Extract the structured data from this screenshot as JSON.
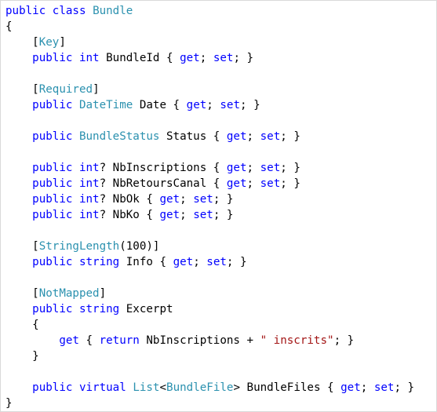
{
  "editor": {
    "colors": {
      "keyword": "#0000ff",
      "type": "#2b91af",
      "string": "#a31515",
      "plain": "#000000",
      "background": "#ffffff"
    },
    "lines": [
      [
        {
          "t": "public",
          "c": "kw"
        },
        {
          "t": " ",
          "c": "pl"
        },
        {
          "t": "class",
          "c": "kw"
        },
        {
          "t": " ",
          "c": "pl"
        },
        {
          "t": "Bundle",
          "c": "ty"
        }
      ],
      [
        {
          "t": "{",
          "c": "pl"
        }
      ],
      [
        {
          "t": "    [",
          "c": "pl"
        },
        {
          "t": "Key",
          "c": "ty"
        },
        {
          "t": "]",
          "c": "pl"
        }
      ],
      [
        {
          "t": "    ",
          "c": "pl"
        },
        {
          "t": "public",
          "c": "kw"
        },
        {
          "t": " ",
          "c": "pl"
        },
        {
          "t": "int",
          "c": "kw"
        },
        {
          "t": " BundleId { ",
          "c": "pl"
        },
        {
          "t": "get",
          "c": "kw"
        },
        {
          "t": "; ",
          "c": "pl"
        },
        {
          "t": "set",
          "c": "kw"
        },
        {
          "t": "; }",
          "c": "pl"
        }
      ],
      [],
      [
        {
          "t": "    [",
          "c": "pl"
        },
        {
          "t": "Required",
          "c": "ty"
        },
        {
          "t": "]",
          "c": "pl"
        }
      ],
      [
        {
          "t": "    ",
          "c": "pl"
        },
        {
          "t": "public",
          "c": "kw"
        },
        {
          "t": " ",
          "c": "pl"
        },
        {
          "t": "DateTime",
          "c": "ty"
        },
        {
          "t": " Date { ",
          "c": "pl"
        },
        {
          "t": "get",
          "c": "kw"
        },
        {
          "t": "; ",
          "c": "pl"
        },
        {
          "t": "set",
          "c": "kw"
        },
        {
          "t": "; }",
          "c": "pl"
        }
      ],
      [],
      [
        {
          "t": "    ",
          "c": "pl"
        },
        {
          "t": "public",
          "c": "kw"
        },
        {
          "t": " ",
          "c": "pl"
        },
        {
          "t": "BundleStatus",
          "c": "ty"
        },
        {
          "t": " Status { ",
          "c": "pl"
        },
        {
          "t": "get",
          "c": "kw"
        },
        {
          "t": "; ",
          "c": "pl"
        },
        {
          "t": "set",
          "c": "kw"
        },
        {
          "t": "; }",
          "c": "pl"
        }
      ],
      [],
      [
        {
          "t": "    ",
          "c": "pl"
        },
        {
          "t": "public",
          "c": "kw"
        },
        {
          "t": " ",
          "c": "pl"
        },
        {
          "t": "int",
          "c": "kw"
        },
        {
          "t": "? NbInscriptions { ",
          "c": "pl"
        },
        {
          "t": "get",
          "c": "kw"
        },
        {
          "t": "; ",
          "c": "pl"
        },
        {
          "t": "set",
          "c": "kw"
        },
        {
          "t": "; }",
          "c": "pl"
        }
      ],
      [
        {
          "t": "    ",
          "c": "pl"
        },
        {
          "t": "public",
          "c": "kw"
        },
        {
          "t": " ",
          "c": "pl"
        },
        {
          "t": "int",
          "c": "kw"
        },
        {
          "t": "? NbRetoursCanal { ",
          "c": "pl"
        },
        {
          "t": "get",
          "c": "kw"
        },
        {
          "t": "; ",
          "c": "pl"
        },
        {
          "t": "set",
          "c": "kw"
        },
        {
          "t": "; }",
          "c": "pl"
        }
      ],
      [
        {
          "t": "    ",
          "c": "pl"
        },
        {
          "t": "public",
          "c": "kw"
        },
        {
          "t": " ",
          "c": "pl"
        },
        {
          "t": "int",
          "c": "kw"
        },
        {
          "t": "? NbOk { ",
          "c": "pl"
        },
        {
          "t": "get",
          "c": "kw"
        },
        {
          "t": "; ",
          "c": "pl"
        },
        {
          "t": "set",
          "c": "kw"
        },
        {
          "t": "; }",
          "c": "pl"
        }
      ],
      [
        {
          "t": "    ",
          "c": "pl"
        },
        {
          "t": "public",
          "c": "kw"
        },
        {
          "t": " ",
          "c": "pl"
        },
        {
          "t": "int",
          "c": "kw"
        },
        {
          "t": "? NbKo { ",
          "c": "pl"
        },
        {
          "t": "get",
          "c": "kw"
        },
        {
          "t": "; ",
          "c": "pl"
        },
        {
          "t": "set",
          "c": "kw"
        },
        {
          "t": "; }",
          "c": "pl"
        }
      ],
      [],
      [
        {
          "t": "    [",
          "c": "pl"
        },
        {
          "t": "StringLength",
          "c": "ty"
        },
        {
          "t": "(100)]",
          "c": "pl"
        }
      ],
      [
        {
          "t": "    ",
          "c": "pl"
        },
        {
          "t": "public",
          "c": "kw"
        },
        {
          "t": " ",
          "c": "pl"
        },
        {
          "t": "string",
          "c": "kw"
        },
        {
          "t": " Info { ",
          "c": "pl"
        },
        {
          "t": "get",
          "c": "kw"
        },
        {
          "t": "; ",
          "c": "pl"
        },
        {
          "t": "set",
          "c": "kw"
        },
        {
          "t": "; }",
          "c": "pl"
        }
      ],
      [],
      [
        {
          "t": "    [",
          "c": "pl"
        },
        {
          "t": "NotMapped",
          "c": "ty"
        },
        {
          "t": "]",
          "c": "pl"
        }
      ],
      [
        {
          "t": "    ",
          "c": "pl"
        },
        {
          "t": "public",
          "c": "kw"
        },
        {
          "t": " ",
          "c": "pl"
        },
        {
          "t": "string",
          "c": "kw"
        },
        {
          "t": " Excerpt",
          "c": "pl"
        }
      ],
      [
        {
          "t": "    {",
          "c": "pl"
        }
      ],
      [
        {
          "t": "        ",
          "c": "pl"
        },
        {
          "t": "get",
          "c": "kw"
        },
        {
          "t": " { ",
          "c": "pl"
        },
        {
          "t": "return",
          "c": "kw"
        },
        {
          "t": " NbInscriptions + ",
          "c": "pl"
        },
        {
          "t": "\" inscrits\"",
          "c": "st"
        },
        {
          "t": "; }",
          "c": "pl"
        }
      ],
      [
        {
          "t": "    }",
          "c": "pl"
        }
      ],
      [],
      [
        {
          "t": "    ",
          "c": "pl"
        },
        {
          "t": "public",
          "c": "kw"
        },
        {
          "t": " ",
          "c": "pl"
        },
        {
          "t": "virtual",
          "c": "kw"
        },
        {
          "t": " ",
          "c": "pl"
        },
        {
          "t": "List",
          "c": "ty"
        },
        {
          "t": "<",
          "c": "pl"
        },
        {
          "t": "BundleFile",
          "c": "ty"
        },
        {
          "t": "> BundleFiles { ",
          "c": "pl"
        },
        {
          "t": "get",
          "c": "kw"
        },
        {
          "t": "; ",
          "c": "pl"
        },
        {
          "t": "set",
          "c": "kw"
        },
        {
          "t": "; }",
          "c": "pl"
        }
      ],
      [
        {
          "t": "}",
          "c": "pl"
        }
      ]
    ]
  }
}
